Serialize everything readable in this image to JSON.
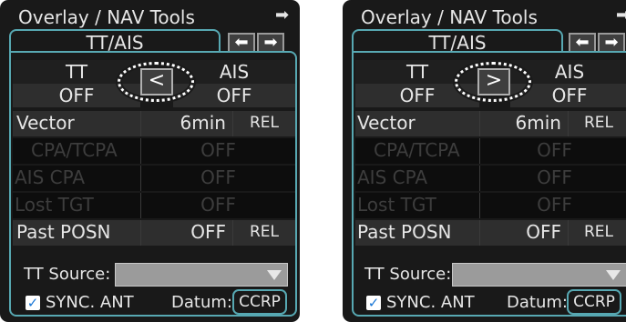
{
  "panels": [
    {
      "title": "Overlay / NAV Tools",
      "title_arrow": "➡",
      "tab": "TT/AIS",
      "nav_left": "⬅",
      "nav_right": "➡",
      "tt_label": "TT",
      "ais_label": "AIS",
      "tt_value": "OFF",
      "ais_value": "OFF",
      "toggle": "<",
      "vector_label": "Vector",
      "vector_value": "6min",
      "vector_mode": "REL",
      "cpa_tcpa_label": "CPA/TCPA",
      "cpa_tcpa_value": "OFF",
      "ais_cpa_label": "AIS CPA",
      "ais_cpa_value": "OFF",
      "lost_tgt_label": "Lost TGT",
      "lost_tgt_value": "OFF",
      "past_posn_label": "Past POSN",
      "past_posn_value": "OFF",
      "past_posn_mode": "REL",
      "tt_source_label": "TT Source:",
      "sync_checkbox": "✓",
      "sync_label": "SYNC. ANT",
      "datum_label": "Datum:",
      "datum_value": "CCRP"
    },
    {
      "title": "Overlay / NAV Tools",
      "title_arrow": "➡",
      "tab": "TT/AIS",
      "nav_left": "⬅",
      "nav_right": "➡",
      "tt_label": "TT",
      "ais_label": "AIS",
      "tt_value": "OFF",
      "ais_value": "OFF",
      "toggle": ">",
      "vector_label": "Vector",
      "vector_value": "6min",
      "vector_mode": "REL",
      "cpa_tcpa_label": "CPA/TCPA",
      "cpa_tcpa_value": "OFF",
      "ais_cpa_label": "AIS CPA",
      "ais_cpa_value": "OFF",
      "lost_tgt_label": "Lost TGT",
      "lost_tgt_value": "OFF",
      "past_posn_label": "Past POSN",
      "past_posn_value": "OFF",
      "past_posn_mode": "REL",
      "tt_source_label": "TT Source:",
      "sync_checkbox": "✓",
      "sync_label": "SYNC. ANT",
      "datum_label": "Datum:",
      "datum_value": "CCRP"
    }
  ]
}
